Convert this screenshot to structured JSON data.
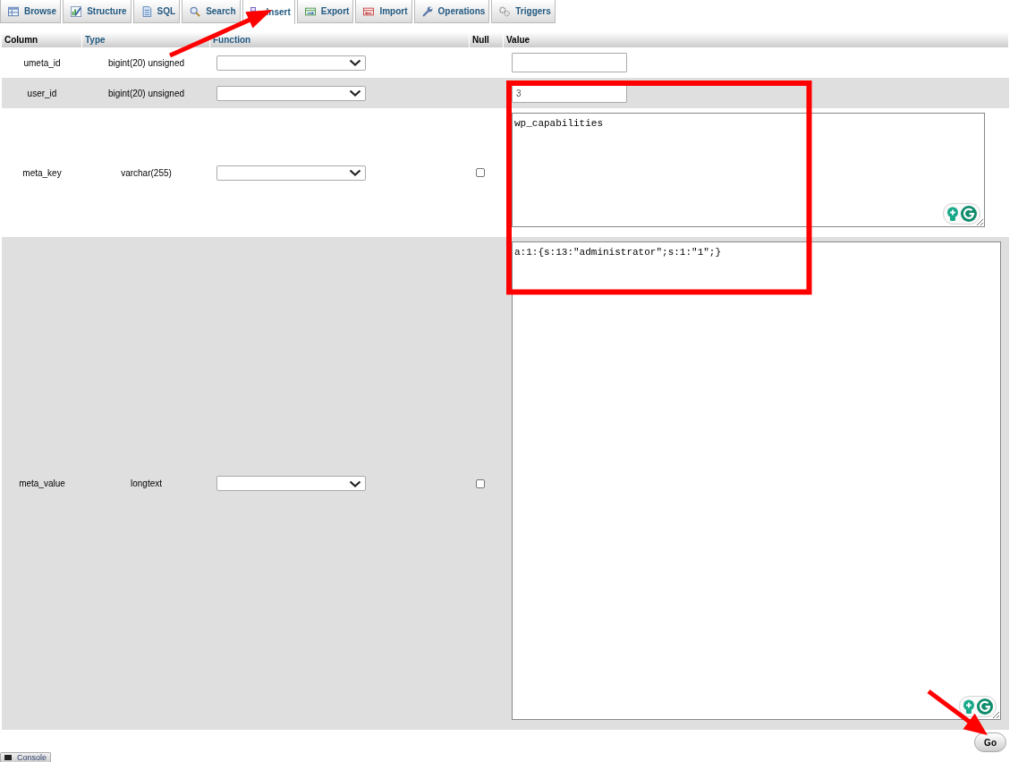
{
  "tabs": [
    {
      "label": "Browse",
      "kind": "browse",
      "selected": false
    },
    {
      "label": "Structure",
      "kind": "structure",
      "selected": false
    },
    {
      "label": "SQL",
      "kind": "sql",
      "selected": false
    },
    {
      "label": "Search",
      "kind": "search",
      "selected": false
    },
    {
      "label": "Insert",
      "kind": "insert",
      "selected": true
    },
    {
      "label": "Export",
      "kind": "export",
      "selected": false
    },
    {
      "label": "Import",
      "kind": "import",
      "selected": false
    },
    {
      "label": "Operations",
      "kind": "operations",
      "selected": false
    },
    {
      "label": "Triggers",
      "kind": "triggers",
      "selected": false
    }
  ],
  "table": {
    "columns": [
      {
        "label": "Column",
        "link": false
      },
      {
        "label": "Type",
        "link": true
      },
      {
        "label": "Function",
        "link": true
      },
      {
        "label": "Null",
        "link": false
      },
      {
        "label": "Value",
        "link": false
      }
    ],
    "rows": [
      {
        "column": "umeta_id",
        "type": "bigint(20) unsigned",
        "kind": "input"
      },
      {
        "column": "user_id",
        "type": "bigint(20) unsigned",
        "kind": "input",
        "value": "3"
      },
      {
        "column": "meta_key",
        "type": "varchar(255)",
        "kind": "textarea",
        "null": {
          "checked": false
        },
        "value": "wp_capabilities"
      },
      {
        "column": "meta_value",
        "type": "longtext",
        "kind": "largetextarea",
        "null": {
          "checked": false
        },
        "value": "a:1:{s:13:\"administrator\";s:1:\"1\";}"
      }
    ]
  },
  "go_button": {
    "label": "Go"
  },
  "console": {
    "label": "Console"
  }
}
